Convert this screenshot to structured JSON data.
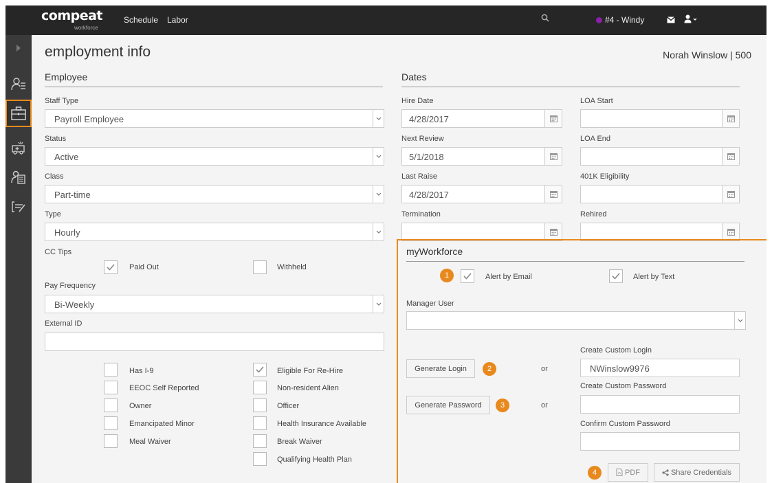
{
  "app": {
    "logo": "compeat",
    "logo_sub": "workforce"
  },
  "nav": {
    "schedule": "Schedule",
    "labor": "Labor",
    "location": "#4 - Windy"
  },
  "colors": {
    "accent": "#e8891d",
    "topbar": "#262626",
    "rail": "#3a3a3a",
    "location_dot": "#8a1fa8"
  },
  "page": {
    "title": "employment info",
    "employee_name": "Norah Winslow  |  500"
  },
  "employee": {
    "heading": "Employee",
    "staff_type": {
      "label": "Staff Type",
      "value": "Payroll Employee"
    },
    "status": {
      "label": "Status",
      "value": "Active"
    },
    "class": {
      "label": "Class",
      "value": "Part-time"
    },
    "type": {
      "label": "Type",
      "value": "Hourly"
    },
    "cc_tips": {
      "label": "CC Tips",
      "paid_out": "Paid Out",
      "withheld": "Withheld"
    },
    "pay_frequency": {
      "label": "Pay Frequency",
      "value": "Bi-Weekly"
    },
    "external_id": {
      "label": "External ID",
      "value": ""
    },
    "checks_left": [
      "Has I-9",
      "EEOC Self Reported",
      "Owner",
      "Emancipated Minor",
      "Meal Waiver"
    ],
    "checks_right": [
      "Eligible For Re-Hire",
      "Non-resident Alien",
      "Officer",
      "Health Insurance Available",
      "Break Waiver",
      "Qualifying Health Plan"
    ]
  },
  "dates": {
    "heading": "Dates",
    "hire_date": {
      "label": "Hire Date",
      "value": "4/28/2017"
    },
    "next_review": {
      "label": "Next Review",
      "value": "5/1/2018"
    },
    "last_raise": {
      "label": "Last Raise",
      "value": "4/28/2017"
    },
    "termination": {
      "label": "Termination",
      "value": ""
    },
    "loa_start": {
      "label": "LOA Start",
      "value": ""
    },
    "loa_end": {
      "label": "LOA End",
      "value": ""
    },
    "eligibility_401k": {
      "label": "401K Eligibility",
      "value": ""
    },
    "rehired": {
      "label": "Rehired",
      "value": ""
    }
  },
  "myworkforce": {
    "heading": "myWorkforce",
    "alert_email": "Alert by Email",
    "alert_text": "Alert by Text",
    "manager_user": {
      "label": "Manager User",
      "value": ""
    },
    "generate_login": "Generate Login",
    "generate_password": "Generate Password",
    "or": "or",
    "custom_login": {
      "label": "Create Custom Login",
      "value": "NWinslow9976"
    },
    "custom_password": {
      "label": "Create Custom Password",
      "value": ""
    },
    "confirm_password": {
      "label": "Confirm Custom Password",
      "value": ""
    },
    "pdf": "PDF",
    "share": "Share Credentials",
    "badges": [
      "1",
      "2",
      "3",
      "4"
    ]
  }
}
